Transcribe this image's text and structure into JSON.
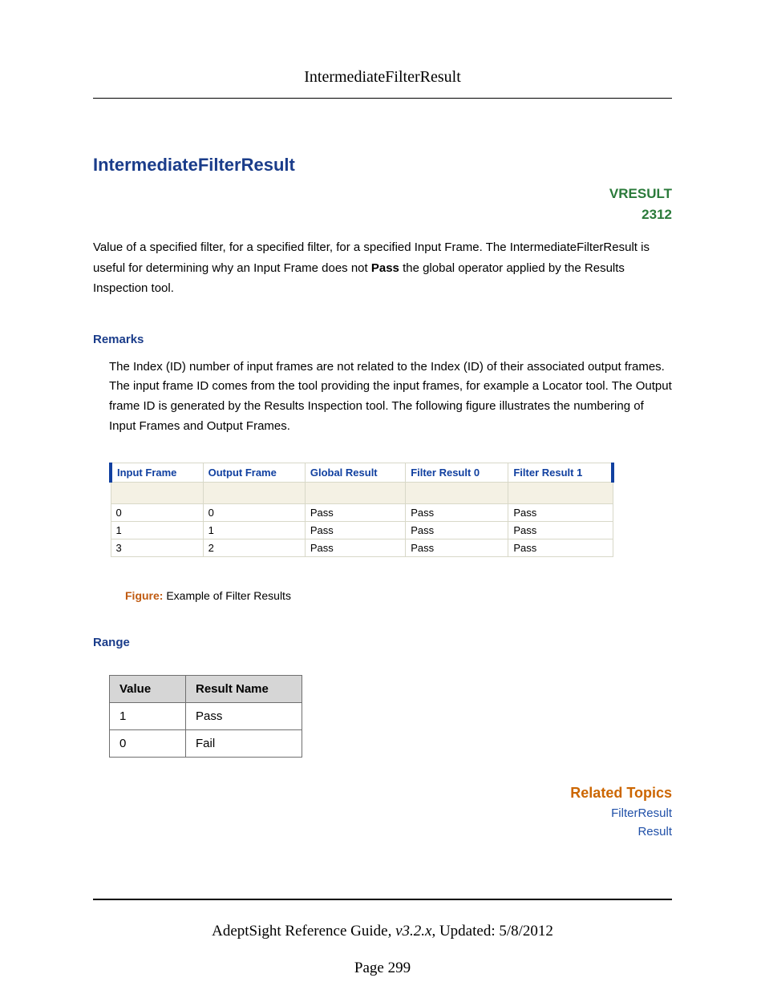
{
  "header": {
    "running_title": "IntermediateFilterResult"
  },
  "title": "IntermediateFilterResult",
  "meta": {
    "type": "VRESULT",
    "code": "2312"
  },
  "intro": {
    "pre": "Value of a specified filter, for a specified filter, for a specified Input Frame. The IntermediateFilterResult is useful for determining why an Input Frame does not ",
    "bold": "Pass",
    "post": " the global operator applied by the Results Inspection tool."
  },
  "remarks": {
    "label": "Remarks",
    "text": "The Index (ID) number of input frames are not related to the Index (ID) of their associated output frames. The input frame ID comes from the tool providing the input frames, for example a Locator tool. The Output frame ID is generated by the Results Inspection tool. The following figure illustrates the numbering of Input Frames and Output Frames."
  },
  "figure": {
    "headers": [
      "Input Frame",
      "Output Frame",
      "Global Result",
      "Filter Result 0",
      "Filter Result 1"
    ],
    "rows": [
      [
        "0",
        "0",
        "Pass",
        "Pass",
        "Pass"
      ],
      [
        "1",
        "1",
        "Pass",
        "Pass",
        "Pass"
      ],
      [
        "3",
        "2",
        "Pass",
        "Pass",
        "Pass"
      ]
    ],
    "caption_label": "Figure:",
    "caption_text": " Example of Filter Results"
  },
  "range": {
    "label": "Range",
    "headers": [
      "Value",
      "Result Name"
    ],
    "rows": [
      [
        "1",
        "Pass"
      ],
      [
        "0",
        "Fail"
      ]
    ]
  },
  "related": {
    "title": "Related Topics",
    "links": [
      "FilterResult",
      "Result"
    ]
  },
  "footer": {
    "doc_title": "AdeptSight Reference Guide",
    "version": ", v3.2.x",
    "updated": ", Updated: 5/8/2012",
    "page_label": "Page 299"
  }
}
